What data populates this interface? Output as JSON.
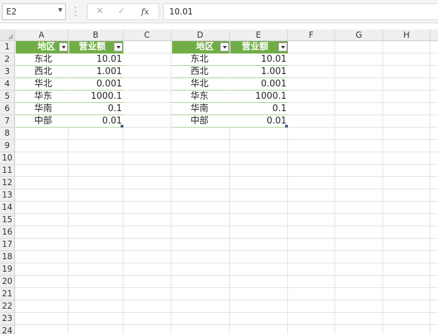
{
  "formula_bar": {
    "name_box": "E2",
    "cancel_glyph": "✕",
    "confirm_glyph": "✓",
    "fx_label": "fx",
    "content": "10.01"
  },
  "columns": [
    "A",
    "B",
    "C",
    "D",
    "E",
    "F",
    "G",
    "H"
  ],
  "rows": [
    "1",
    "2",
    "3",
    "4",
    "5",
    "6",
    "7",
    "8",
    "9",
    "10",
    "11",
    "12",
    "13",
    "14",
    "15",
    "16",
    "17",
    "18",
    "19",
    "20",
    "21",
    "22",
    "23",
    "24"
  ],
  "table_left": {
    "headers": [
      "地区",
      "营业额"
    ],
    "rows": [
      [
        "东北",
        "10.01"
      ],
      [
        "西北",
        "1.001"
      ],
      [
        "华北",
        "0.001"
      ],
      [
        "华东",
        "1000.1"
      ],
      [
        "华南",
        "0.1"
      ],
      [
        "中部",
        "0.01"
      ]
    ]
  },
  "table_right": {
    "headers": [
      "地区",
      "营业额"
    ],
    "rows": [
      [
        "东北",
        "10.01"
      ],
      [
        "西北",
        "1.001"
      ],
      [
        "华北",
        "0.001"
      ],
      [
        "华东",
        "1000.1"
      ],
      [
        "华南",
        "0.1"
      ],
      [
        "中部",
        "0.01"
      ]
    ]
  },
  "colors": {
    "table_header": "#70ad47",
    "table_border": "#a9d08e",
    "grid": "#e1e1e1"
  },
  "icons": [
    "dropdown-icon",
    "cancel-icon",
    "confirm-icon",
    "function-icon",
    "filter-dropdown-icon"
  ]
}
